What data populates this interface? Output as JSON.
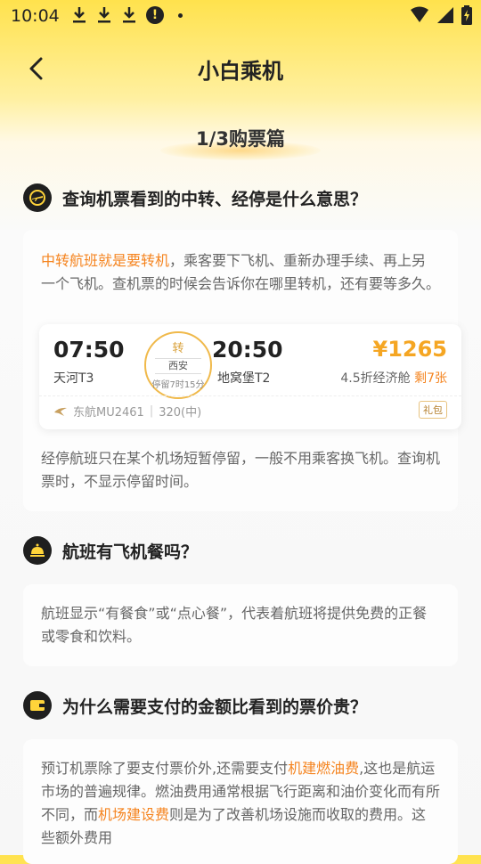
{
  "status_bar": {
    "time": "10:04",
    "icons": [
      "download-icon",
      "download-icon",
      "download-icon",
      "alert-icon",
      "dot-icon",
      "wifi-icon",
      "signal-icon",
      "battery-charging-icon"
    ]
  },
  "nav": {
    "back_icon": "back-arrow-icon",
    "title": "小白乘机"
  },
  "section": {
    "title": "1/3购票篇"
  },
  "q1": {
    "icon": "airplane-badge-icon",
    "title": "查询机票看到的中转、经停是什么意思？",
    "para1_highlight": "中转航班就是要转机",
    "para1_rest": "，乘客要下飞机、重新办理手续、再上另一个飞机。查机票的时候会告诉你在哪里转机，还有要等多久。",
    "flight": {
      "depart_time": "07:50",
      "depart_airport": "天河T3",
      "transfer_label": "转",
      "transfer_city": "西安",
      "transfer_stay": "停留7时15分",
      "arrive_time": "20:50",
      "arrive_airport": "地窝堡T2",
      "price": "¥1265",
      "fare_class": "4.5折经济舱",
      "remaining": "剩7张",
      "airline": "东航MU2461",
      "aircraft": "320(中)",
      "gift": "礼包"
    },
    "para2": "经停航班只在某个机场短暂停留，一般不用乘客换飞机。查询机票时，不显示停留时间。"
  },
  "q2": {
    "icon": "meal-cloche-icon",
    "title": "航班有飞机餐吗？",
    "para": "航班显示“有餐食”或“点心餐”，代表着航班将提供免费的正餐或零食和饮料。"
  },
  "q3": {
    "icon": "wallet-icon",
    "title": "为什么需要支付的金额比看到的票价贵？",
    "para_a": "预订机票除了要支付票价外,还需要支付",
    "para_hl1": "机建燃油费",
    "para_b": ",这也是航运市场的普遍规律。燃油费用通常根据飞行距离和油价变化而有所不同，而",
    "para_hl2": "机场建设费",
    "para_c": "则是为了改善机场设施而收取的费用。这些额外费用"
  },
  "colors": {
    "accent": "#F5841F",
    "price": "#F5A623",
    "header_yellow": "#FFE24D"
  }
}
